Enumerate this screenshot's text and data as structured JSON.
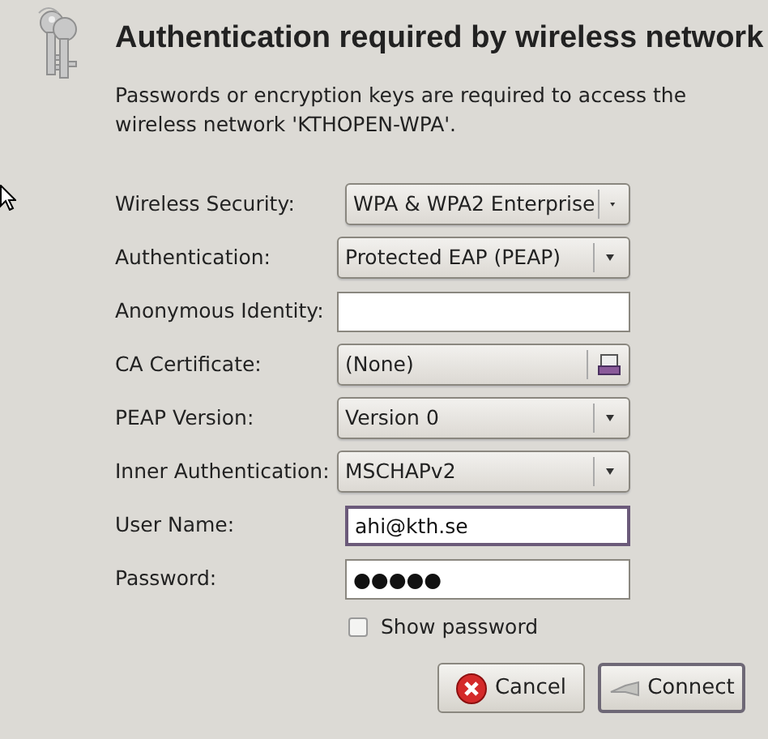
{
  "dialog": {
    "heading": "Authentication required by wireless network",
    "message": "Passwords or encryption keys are required to access the wireless network 'KTHOPEN-WPA'."
  },
  "fields": [
    {
      "label": "Wireless Security:",
      "kind": "combo",
      "value": "WPA & WPA2 Enterprise"
    },
    {
      "label": "Authentication:",
      "kind": "combo",
      "value": "Protected EAP (PEAP)"
    },
    {
      "label": "Anonymous Identity:",
      "kind": "entry"
    },
    {
      "label": "CA Certificate:",
      "kind": "file",
      "value": "(None)"
    },
    {
      "label": "PEAP Version:",
      "kind": "combo",
      "value": "Version 0"
    },
    {
      "label": "Inner Authentication:",
      "kind": "combo",
      "value": "MSCHAPv2"
    },
    {
      "label": "User Name:",
      "kind": "entry",
      "value": "ahi@kth.se",
      "focused": true
    },
    {
      "label": "Password:",
      "kind": "entry",
      "value": "●●●●●"
    }
  ],
  "show_password": {
    "label": "Show password",
    "checked": false
  },
  "buttons": [
    {
      "label": "Cancel",
      "kind": "cancel",
      "default": false
    },
    {
      "label": "Connect",
      "kind": "connect",
      "default": true
    }
  ]
}
